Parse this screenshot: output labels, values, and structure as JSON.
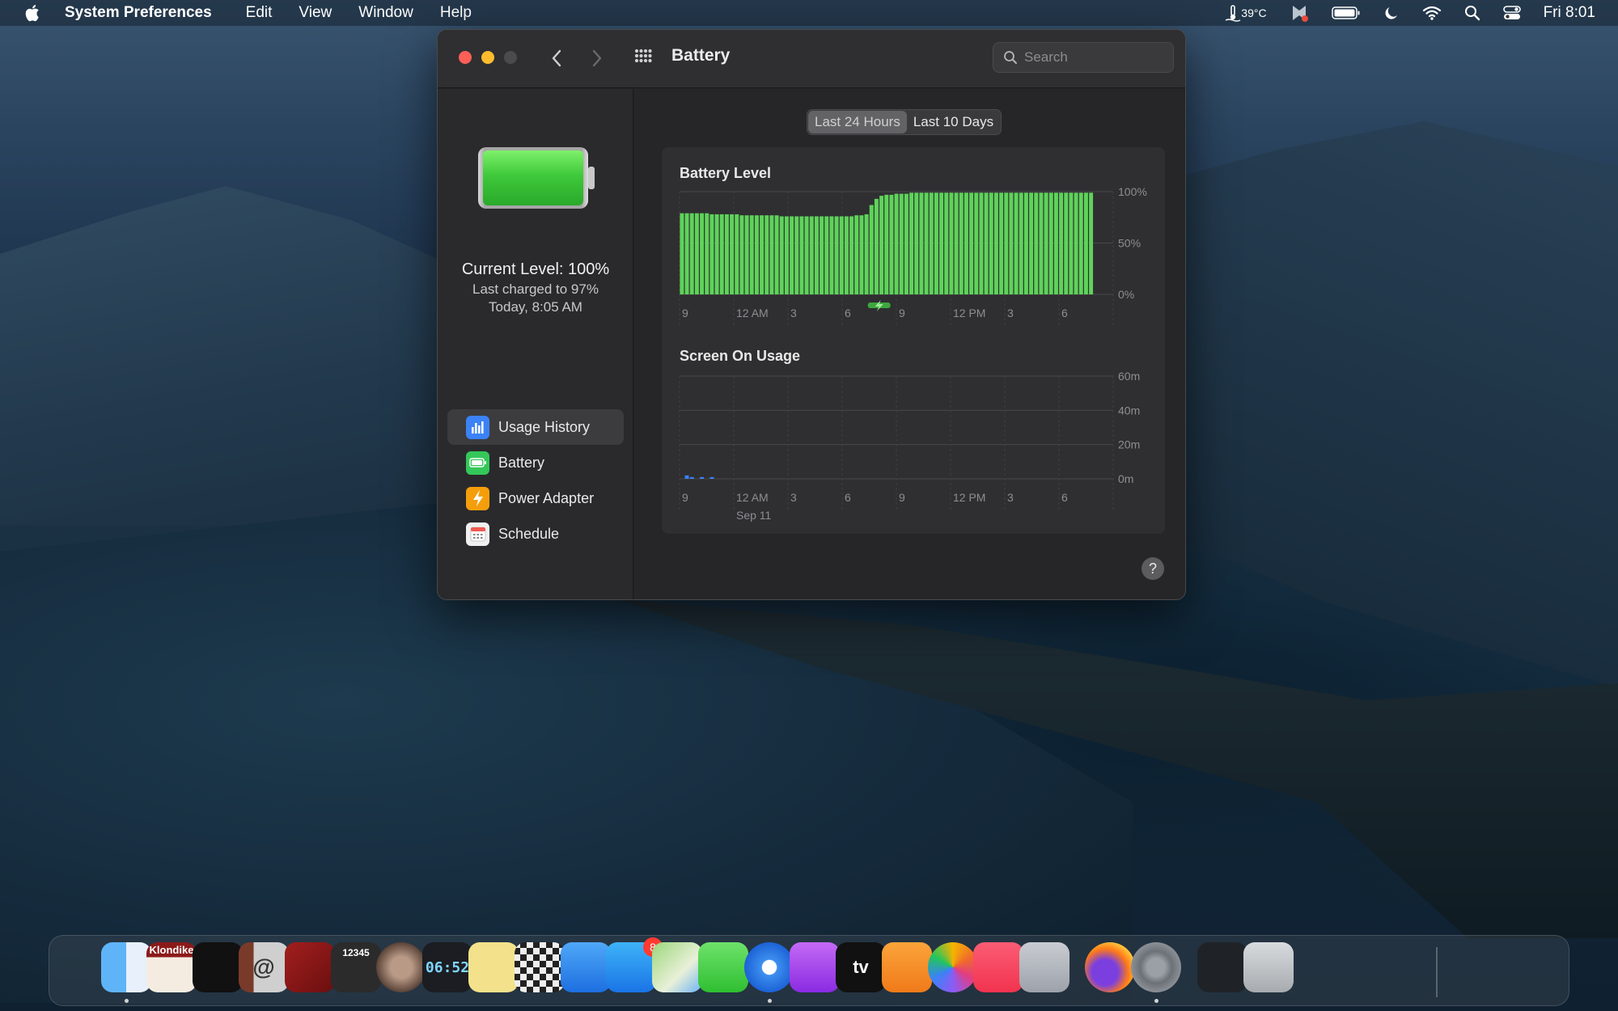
{
  "menubar": {
    "app_name": "System Preferences",
    "items": [
      "Edit",
      "View",
      "Window",
      "Help"
    ],
    "temperature": "39°C",
    "clock": "Fri 8:01"
  },
  "window": {
    "title": "Battery",
    "search_placeholder": "Search"
  },
  "sidebar": {
    "current_level": "Current Level: 100%",
    "last_charged": "Last charged to 97%",
    "last_charged_time": "Today, 8:05 AM",
    "items": [
      {
        "label": "Usage History",
        "icon": "usage-history-icon",
        "color": "#3b82f6"
      },
      {
        "label": "Battery",
        "icon": "battery-icon",
        "color": "#34c759"
      },
      {
        "label": "Power Adapter",
        "icon": "power-adapter-icon",
        "color": "#f59e0b"
      },
      {
        "label": "Schedule",
        "icon": "schedule-icon",
        "color": "#f0f0f0"
      }
    ]
  },
  "content": {
    "tabs": [
      "Last 24 Hours",
      "Last 10 Days"
    ],
    "active_tab": "Last 24 Hours",
    "help_label": "?"
  },
  "chart_data": [
    {
      "type": "bar",
      "title": "Battery Level",
      "y_ticks": [
        "100%",
        "50%",
        "0%"
      ],
      "ylim": [
        0,
        100
      ],
      "x_ticks": [
        "9",
        "12 AM",
        "3",
        "6",
        "9",
        "12 PM",
        "3",
        "6"
      ],
      "values": [
        79,
        79,
        79,
        79,
        79,
        79,
        78,
        78,
        78,
        78,
        78,
        78,
        77,
        77,
        77,
        77,
        77,
        77,
        77,
        77,
        76,
        76,
        76,
        76,
        76,
        76,
        76,
        76,
        76,
        76,
        76,
        76,
        76,
        76,
        76,
        77,
        77,
        78,
        87,
        93,
        96,
        97,
        97,
        98,
        98,
        98,
        99,
        99,
        99,
        99,
        99,
        99,
        99,
        99,
        99,
        99,
        99,
        99,
        99,
        99,
        99,
        99,
        99,
        99,
        99,
        99,
        99,
        99,
        99,
        99,
        99,
        99,
        99,
        99,
        99,
        99,
        99,
        99,
        99,
        99,
        99,
        99,
        99
      ],
      "color": "#5ed35a",
      "charging_marker": "charging-icon"
    },
    {
      "type": "bar",
      "title": "Screen On Usage",
      "y_ticks": [
        "60m",
        "40m",
        "20m",
        "0m"
      ],
      "ylim": [
        0,
        60
      ],
      "x_ticks": [
        "9",
        "12 AM",
        "3",
        "6",
        "9",
        "12 PM",
        "3",
        "6"
      ],
      "date_label": "Sep 11",
      "values": [
        0,
        2,
        1,
        0,
        1,
        0,
        1,
        0,
        0,
        0,
        0,
        0,
        0,
        0,
        0,
        0,
        0,
        0,
        0,
        0,
        0,
        0,
        0,
        0,
        0,
        0,
        0,
        0,
        0,
        0,
        0,
        0,
        0,
        0,
        0,
        0,
        0,
        0,
        0,
        0,
        0,
        0,
        0,
        0,
        0,
        0,
        0,
        0,
        0,
        0,
        0,
        0,
        0,
        0,
        0,
        0,
        0,
        0,
        0,
        0,
        0,
        0,
        0,
        0,
        0,
        0,
        0,
        0,
        0,
        0,
        0,
        0,
        0,
        0,
        0,
        0,
        0,
        0,
        0,
        0,
        0,
        0,
        0
      ],
      "color": "#3b82f6"
    }
  ],
  "dock": {
    "apps": [
      {
        "name": "Finder",
        "icon": "finder-icon",
        "running": true
      },
      {
        "name": "Klondike",
        "label": "Klondike",
        "icon": "klondike-icon"
      },
      {
        "name": "Scrobbles",
        "icon": "app-icon"
      },
      {
        "name": "Mail Contacts",
        "label": "@",
        "icon": "contacts-icon"
      },
      {
        "name": "Notebook",
        "icon": "notebook-icon"
      },
      {
        "name": "Calculator",
        "label": "12345",
        "icon": "calculator-icon"
      },
      {
        "name": "Disk Utility",
        "icon": "disk-icon"
      },
      {
        "name": "Clock",
        "label": "06:52",
        "icon": "clock-icon"
      },
      {
        "name": "Stickies",
        "icon": "stickies-icon"
      },
      {
        "name": "Chess",
        "icon": "chess-icon"
      },
      {
        "name": "Mail",
        "icon": "mail-icon"
      },
      {
        "name": "App Store",
        "icon": "app-store-icon",
        "badge": "8"
      },
      {
        "name": "Maps",
        "icon": "maps-icon"
      },
      {
        "name": "Messages",
        "icon": "messages-icon"
      },
      {
        "name": "Safari",
        "icon": "safari-icon",
        "running": true
      },
      {
        "name": "Podcasts",
        "icon": "podcasts-icon"
      },
      {
        "name": "TV",
        "label": "tv",
        "icon": "tv-icon"
      },
      {
        "name": "Books",
        "icon": "books-icon"
      },
      {
        "name": "Photos",
        "icon": "photos-icon"
      },
      {
        "name": "Music",
        "icon": "music-icon"
      },
      {
        "name": "Launchpad",
        "icon": "launchpad-icon"
      },
      {
        "name": "Firefox",
        "icon": "firefox-icon"
      },
      {
        "name": "System Preferences",
        "icon": "system-preferences-icon",
        "running": true
      },
      {
        "name": "Preview",
        "icon": "preview-icon"
      },
      {
        "name": "Trash",
        "icon": "trash-icon"
      }
    ]
  }
}
